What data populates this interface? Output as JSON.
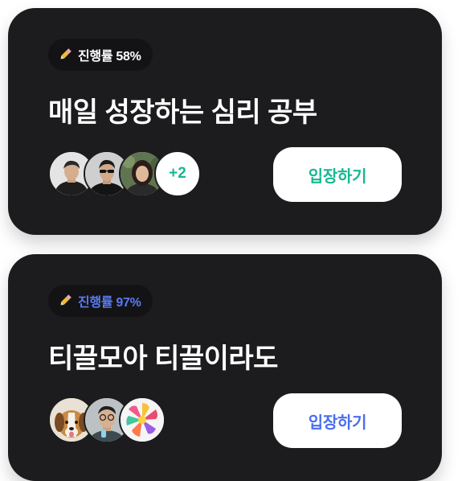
{
  "cards": [
    {
      "progress_label": "진행률 58%",
      "progress_icon": "pencil-icon",
      "progress_color": "#ffffff",
      "title": "매일 성장하는 심리 공부",
      "member_extra": "+2",
      "enter_label": "입장하기",
      "enter_color": "#16b894",
      "avatars": [
        "avatar-man-black-jacket",
        "avatar-man-sunglasses",
        "avatar-woman-outdoor"
      ]
    },
    {
      "progress_label": "진행률 97%",
      "progress_icon": "pencil-icon",
      "progress_color": "#5a7bf2",
      "title": "티끌모아 티끌이라도",
      "enter_label": "입장하기",
      "enter_color": "#4a6ef0",
      "avatars": [
        "avatar-beagle-dog",
        "avatar-man-glasses",
        "avatar-pink-flower"
      ]
    }
  ]
}
